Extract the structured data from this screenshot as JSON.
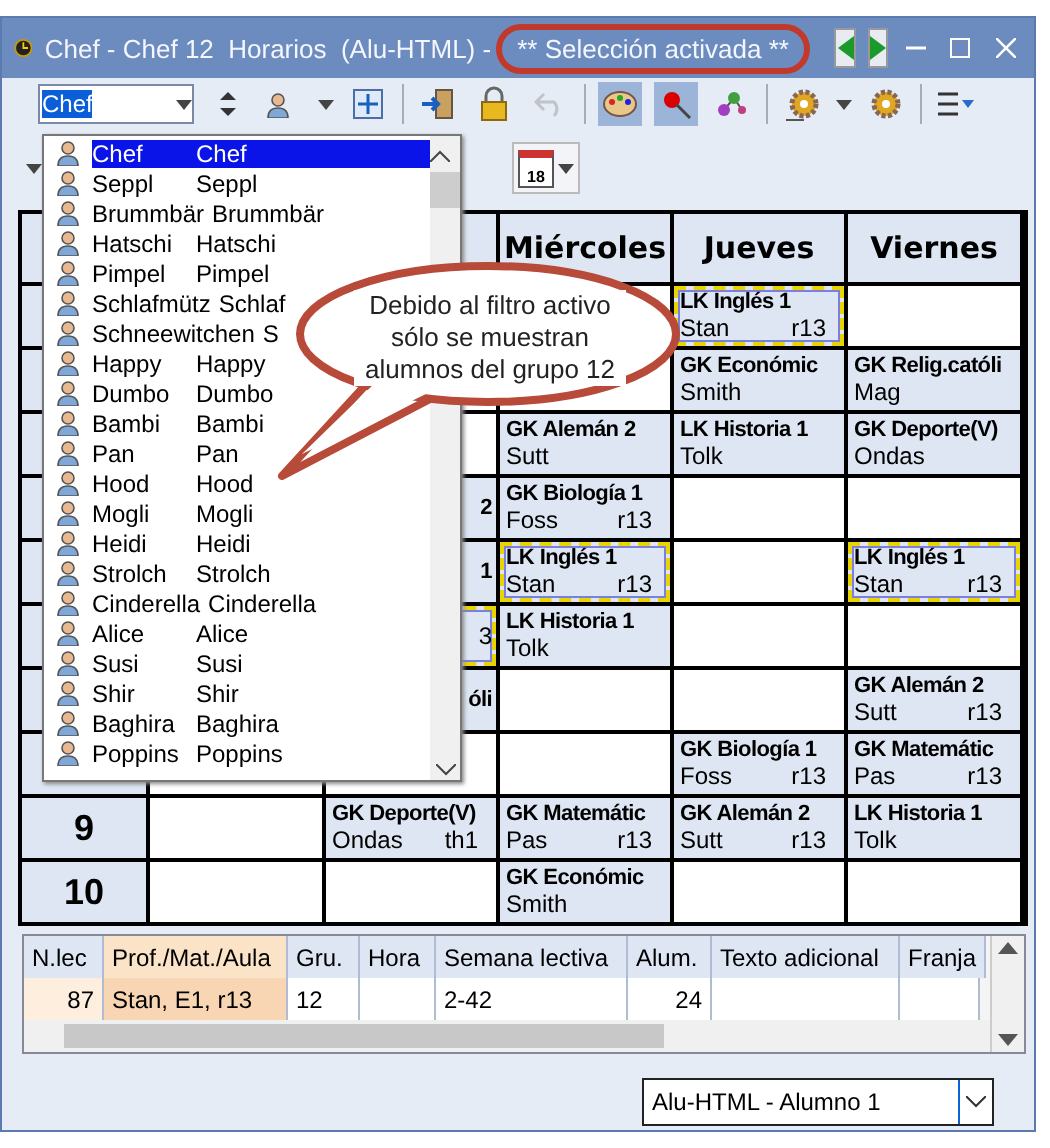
{
  "window": {
    "title": "Chef - Chef 12  Horarios  (Alu-HTML) -",
    "status": "** Selección activada **"
  },
  "toolbar": {
    "element_field": {
      "value": "Chef"
    }
  },
  "calendar_day": "18",
  "element_list": {
    "items": [
      {
        "name": "Chef",
        "short": "Chef",
        "selected": true
      },
      {
        "name": "Seppl",
        "short": "Seppl",
        "selected": false
      },
      {
        "name": "Brummbär",
        "short": "Brummbär",
        "selected": false
      },
      {
        "name": "Hatschi",
        "short": "Hatschi",
        "selected": false
      },
      {
        "name": "Pimpel",
        "short": "Pimpel",
        "selected": false
      },
      {
        "name": "Schlafmütz",
        "short": "Schlaf",
        "selected": false
      },
      {
        "name": "Schneewitchen",
        "short": "S",
        "selected": false
      },
      {
        "name": "Happy",
        "short": "Happy",
        "selected": false
      },
      {
        "name": "Dumbo",
        "short": "Dumbo",
        "selected": false
      },
      {
        "name": "Bambi",
        "short": "Bambi",
        "selected": false
      },
      {
        "name": "Pan",
        "short": "Pan",
        "selected": false
      },
      {
        "name": "Hood",
        "short": "Hood",
        "selected": false
      },
      {
        "name": "Mogli",
        "short": "Mogli",
        "selected": false
      },
      {
        "name": "Heidi",
        "short": "Heidi",
        "selected": false
      },
      {
        "name": "Strolch",
        "short": "Strolch",
        "selected": false
      },
      {
        "name": "Cinderella",
        "short": "Cinderella",
        "selected": false
      },
      {
        "name": "Alice",
        "short": "Alice",
        "selected": false
      },
      {
        "name": "Susi",
        "short": "Susi",
        "selected": false
      },
      {
        "name": "Shir",
        "short": "Shir",
        "selected": false
      },
      {
        "name": "Baghira",
        "short": "Baghira",
        "selected": false
      },
      {
        "name": "Poppins",
        "short": "Poppins",
        "selected": false
      }
    ]
  },
  "callout": "Debido al filtro activo sólo se muestran alumnos del grupo 12",
  "timetable": {
    "day_headers": [
      "Miércoles",
      "Jueves",
      "Viernes"
    ],
    "rows": [
      {
        "cells": [
          null,
          null,
          null,
          {
            "title": "LK Inglés 1",
            "teacher": "Stan",
            "room": "r13",
            "highlighted": true
          },
          null
        ]
      },
      {
        "cells": [
          null,
          null,
          null,
          {
            "title": "GK Económic",
            "teacher": "Smith",
            "highlighted": false
          },
          {
            "title": "GK Relig.católi",
            "teacher": "Mag",
            "highlighted": false
          }
        ]
      },
      {
        "cells": [
          null,
          null,
          {
            "title": "GK Alemán 2",
            "teacher": "Sutt",
            "highlighted": false
          },
          {
            "title": "LK Historia 1",
            "teacher": "Tolk",
            "highlighted": false
          },
          {
            "title": "GK Deporte(V)",
            "teacher": "Ondas",
            "highlighted": false
          }
        ]
      },
      {
        "cells": [
          null,
          {
            "kind": "partial",
            "title": "2",
            "highlighted": false
          },
          {
            "title": "GK Biología 1",
            "teacher": "Foss",
            "room": "r13",
            "highlighted": false
          },
          null,
          null
        ]
      },
      {
        "cells": [
          null,
          {
            "kind": "partial",
            "title": "1",
            "highlighted": false
          },
          {
            "title": "LK Inglés 1",
            "teacher": "Stan",
            "room": "r13",
            "highlighted": true
          },
          null,
          {
            "title": "LK Inglés 1",
            "teacher": "Stan",
            "room": "r13",
            "highlighted": true
          }
        ]
      },
      {
        "cells": [
          null,
          {
            "kind": "partial",
            "room": "3",
            "highlighted": true
          },
          {
            "title": "LK Historia 1",
            "teacher": "Tolk",
            "highlighted": false
          },
          null,
          null
        ]
      },
      {
        "cells": [
          null,
          {
            "kind": "partial",
            "title": "óli",
            "highlighted": false
          },
          null,
          null,
          {
            "title": "GK Alemán 2",
            "teacher": "Sutt",
            "room": "r13",
            "highlighted": false
          }
        ]
      },
      {
        "cells": [
          null,
          null,
          null,
          {
            "title": "GK Biología 1",
            "teacher": "Foss",
            "room": "r13",
            "highlighted": false
          },
          {
            "title": "GK Matemátic",
            "teacher": "Pas",
            "room": "r13",
            "highlighted": false
          }
        ]
      },
      {
        "hour": "9",
        "cells": [
          null,
          {
            "title": "GK Deporte(V)",
            "teacher": "Ondas",
            "room": "th1",
            "highlighted": false
          },
          {
            "title": "GK Matemátic",
            "teacher": "Pas",
            "room": "r13",
            "highlighted": false
          },
          {
            "title": "GK Alemán 2",
            "teacher": "Sutt",
            "room": "r13",
            "highlighted": false
          },
          {
            "title": "LK Historia 1",
            "teacher": "Tolk",
            "highlighted": false
          }
        ]
      },
      {
        "hour": "10",
        "cells": [
          null,
          null,
          {
            "title": "GK Económic",
            "teacher": "Smith",
            "highlighted": false
          },
          null,
          null
        ]
      }
    ]
  },
  "lessons": {
    "columns": [
      {
        "label": "N.lec",
        "highlighted": false
      },
      {
        "label": "Prof./Mat./Aula",
        "highlighted": true
      },
      {
        "label": "Gru.",
        "highlighted": false
      },
      {
        "label": "Hora",
        "highlighted": false
      },
      {
        "label": "Semana lectiva",
        "highlighted": false
      },
      {
        "label": "Alum.",
        "highlighted": false
      },
      {
        "label": "Texto adicional",
        "highlighted": false
      },
      {
        "label": "Franja",
        "highlighted": false
      }
    ],
    "rows": [
      {
        "cells": [
          "87",
          "Stan, E1, r13",
          "12",
          null,
          "2-42",
          "24",
          null,
          null
        ]
      }
    ]
  },
  "view_selector": {
    "value": "Alu-HTML - Alumno 1"
  }
}
